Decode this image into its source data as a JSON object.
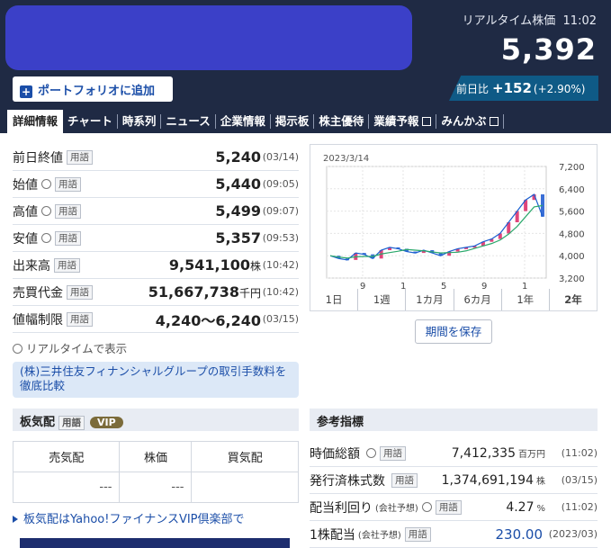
{
  "header": {
    "realtime_label": "リアルタイム株価",
    "realtime_time": "11:02",
    "price": "5,392",
    "portfolio_button": "ポートフォリオに追加",
    "change": {
      "label": "前日比",
      "value": "+152",
      "pct": "(+2.90%)"
    }
  },
  "tabs": [
    "詳細情報",
    "チャート",
    "時系列",
    "ニュース",
    "企業情報",
    "掲示板",
    "株主優待",
    "業績予報",
    "みんかぶ"
  ],
  "tag_label": "用語",
  "details": [
    {
      "label": "前日終値",
      "value": "5,240",
      "unit": "",
      "time": "(03/14)",
      "clock": false
    },
    {
      "label": "始値",
      "value": "5,440",
      "unit": "",
      "time": "(09:05)",
      "clock": true
    },
    {
      "label": "高値",
      "value": "5,499",
      "unit": "",
      "time": "(09:07)",
      "clock": true
    },
    {
      "label": "安値",
      "value": "5,357",
      "unit": "",
      "time": "(09:53)",
      "clock": true
    },
    {
      "label": "出来高",
      "value": "9,541,100",
      "unit": "株",
      "time": "(10:42)",
      "clock": false
    },
    {
      "label": "売買代金",
      "value": "51,667,738",
      "unit": "千円",
      "time": "(10:42)",
      "clock": false
    },
    {
      "label": "値幅制限",
      "value": "4,240～6,240",
      "unit": "",
      "time": "(03/15)",
      "clock": false
    }
  ],
  "realtime_note": "リアルタイムで表示",
  "promo": "(株)三井住友フィナンシャルグループの取引手数料を徹底比較",
  "itakehai": {
    "title": "板気配",
    "vip": "VIP",
    "headers": [
      "売気配",
      "株価",
      "買気配"
    ],
    "cells": [
      "---",
      "---",
      ""
    ],
    "link": "板気配はYahoo!ファイナンスVIP倶楽部で"
  },
  "chart": {
    "date": "2023/3/14",
    "periods": [
      "1日",
      "1週",
      "1カ月",
      "6カ月",
      "1年",
      "2年"
    ],
    "save_button": "期間を保存"
  },
  "chart_data": {
    "type": "line",
    "x_ticks": [
      "9",
      "1",
      "5",
      "9",
      "1"
    ],
    "y_ticks": [
      "7,200",
      "6,400",
      "5,600",
      "4,800",
      "4,000",
      "3,200"
    ],
    "ylim": [
      3200,
      7200
    ],
    "values": [
      4000,
      3900,
      3850,
      4100,
      4050,
      3900,
      4200,
      4300,
      4250,
      4150,
      4100,
      4200,
      4100,
      4000,
      4150,
      4250,
      4300,
      4350,
      4500,
      4600,
      4800,
      5200,
      5600,
      6000,
      6200,
      5400
    ]
  },
  "reference": {
    "title": "参考指標",
    "rows": [
      {
        "label": "時価総額",
        "note": "",
        "clock": true,
        "value": "7,412,335",
        "unit": "百万円",
        "time": "(11:02)",
        "link": false
      },
      {
        "label": "発行済株式数",
        "note": "",
        "clock": false,
        "value": "1,374,691,194",
        "unit": "株",
        "time": "(03/15)",
        "link": false
      },
      {
        "label": "配当利回り",
        "note": "(会社予想)",
        "clock": true,
        "value": "4.27",
        "unit": "%",
        "time": "(11:02)",
        "link": false
      },
      {
        "label": "1株配当",
        "note": "(会社予想)",
        "clock": false,
        "value": "230.00",
        "unit": "",
        "time": "(2023/03)",
        "link": true
      }
    ]
  }
}
